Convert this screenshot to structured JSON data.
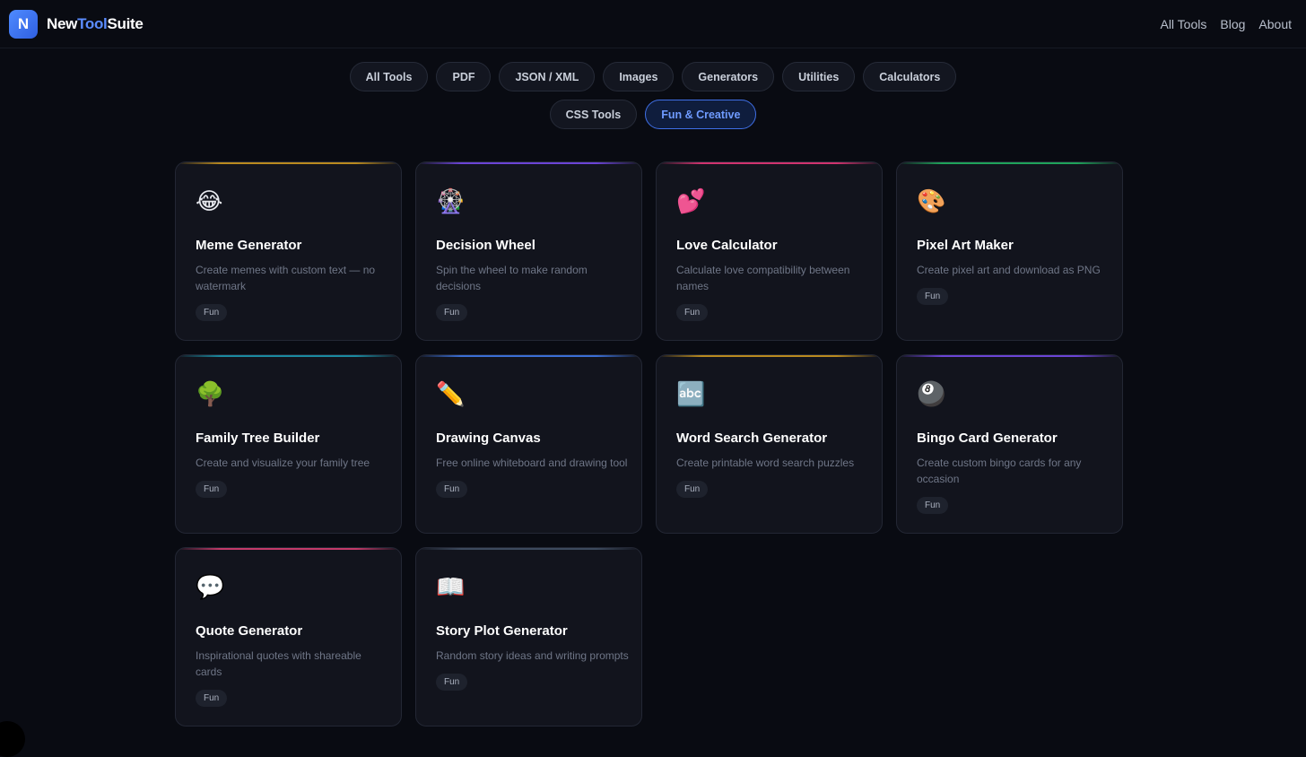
{
  "brand": {
    "logo_letter": "N",
    "name_part1": "New",
    "name_part2": "Tool",
    "name_part3": "Suite"
  },
  "nav": {
    "all_tools": "All Tools",
    "blog": "Blog",
    "about": "About"
  },
  "filters_row1": [
    "All Tools",
    "PDF",
    "JSON / XML",
    "Images",
    "Generators",
    "Utilities",
    "Calculators"
  ],
  "filters_row2": [
    "CSS Tools",
    "Fun & Creative"
  ],
  "active_filter": "Fun & Creative",
  "cards": [
    {
      "emoji": "😂",
      "icon": "laughing-face-icon",
      "title": "Meme Generator",
      "desc": "Create memes with custom text — no watermark",
      "tag": "Fun",
      "accent": "#b98a1f"
    },
    {
      "emoji": "🎡",
      "icon": "ferris-wheel-icon",
      "title": "Decision Wheel",
      "desc": "Spin the wheel to make random decisions",
      "tag": "Fun",
      "accent": "#6b44d6"
    },
    {
      "emoji": "💕",
      "icon": "two-hearts-icon",
      "title": "Love Calculator",
      "desc": "Calculate love compatibility between names",
      "tag": "Fun",
      "accent": "#d0336e"
    },
    {
      "emoji": "🎨",
      "icon": "palette-icon",
      "title": "Pixel Art Maker",
      "desc": "Create pixel art and download as PNG",
      "tag": "Fun",
      "accent": "#1fa35a"
    },
    {
      "emoji": "🌳",
      "icon": "tree-icon",
      "title": "Family Tree Builder",
      "desc": "Create and visualize your family tree",
      "tag": "Fun",
      "accent": "#1a8aa0"
    },
    {
      "emoji": "✏️",
      "icon": "pencil-icon",
      "title": "Drawing Canvas",
      "desc": "Free online whiteboard and drawing tool",
      "tag": "Fun",
      "accent": "#3b6fd6"
    },
    {
      "emoji": "🔤",
      "icon": "abc-icon",
      "title": "Word Search Generator",
      "desc": "Create printable word search puzzles",
      "tag": "Fun",
      "accent": "#b98a1f"
    },
    {
      "emoji": "🎱",
      "icon": "billiard-ball-icon",
      "title": "Bingo Card Generator",
      "desc": "Create custom bingo cards for any occasion",
      "tag": "Fun",
      "accent": "#6b44d6"
    },
    {
      "emoji": "💬",
      "icon": "speech-bubble-icon",
      "title": "Quote Generator",
      "desc": "Inspirational quotes with shareable cards",
      "tag": "Fun",
      "accent": "#c43a6a"
    },
    {
      "emoji": "📖",
      "icon": "open-book-icon",
      "title": "Story Plot Generator",
      "desc": "Random story ideas and writing prompts",
      "tag": "Fun",
      "accent": "#3d4a5e"
    }
  ]
}
